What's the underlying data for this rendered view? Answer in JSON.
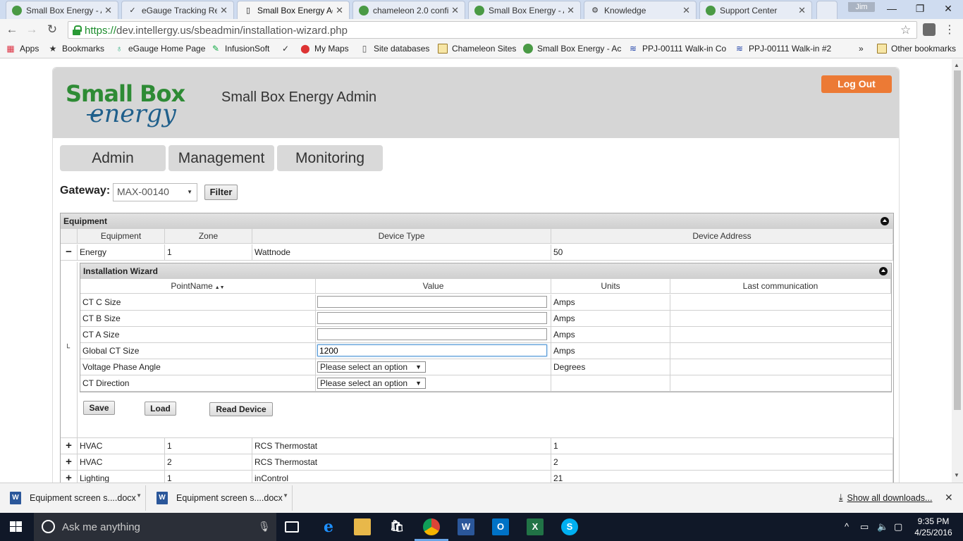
{
  "browser": {
    "tabs": [
      {
        "title": "Small Box Energy - A",
        "icon": "sbe-favicon"
      },
      {
        "title": "eGauge Tracking Re",
        "icon": "check-favicon"
      },
      {
        "title": "Small Box Energy Ad",
        "icon": "page-favicon",
        "active": true
      },
      {
        "title": "chameleon 2.0 confi",
        "icon": "sbe-favicon"
      },
      {
        "title": "Small Box Energy - A",
        "icon": "sbe-favicon"
      },
      {
        "title": "Knowledge",
        "icon": "gear-favicon"
      },
      {
        "title": "Support Center",
        "icon": "sbe-favicon"
      }
    ],
    "profile_name": "Jim",
    "url_scheme": "https://",
    "url_rest": "dev.intellergy.us/sbeadmin/installation-wizard.php",
    "bookmarks": [
      {
        "label": "Apps",
        "icon": "apps-grid-icon"
      },
      {
        "label": "Bookmarks",
        "icon": "star-icon"
      },
      {
        "label": "eGauge Home Page",
        "icon": "egauge-icon"
      },
      {
        "label": "InfusionSoft",
        "icon": "infusionsoft-icon"
      },
      {
        "label": "",
        "icon": "check-icon"
      },
      {
        "label": "My Maps",
        "icon": "map-pin-icon"
      },
      {
        "label": "Site databases",
        "icon": "page-icon"
      },
      {
        "label": "Chameleon Sites",
        "icon": "folder-icon"
      },
      {
        "label": "Small Box Energy - Ac",
        "icon": "sbe-favicon"
      },
      {
        "label": "PPJ-00111 Walk-in Co",
        "icon": "kcp-icon"
      },
      {
        "label": "PPJ-00111 Walk-in #2",
        "icon": "kcp-icon"
      }
    ],
    "more_bookmarks": "»",
    "other_bookmarks": "Other bookmarks"
  },
  "site": {
    "logo_top": "Small Box",
    "logo_bottom": "energy",
    "title": "Small Box Energy Admin",
    "logout_label": "Log Out",
    "nav": [
      "Admin",
      "Management",
      "Monitoring"
    ],
    "gateway_label": "Gateway:",
    "gateway_value": "MAX-00140",
    "filter_label": "Filter"
  },
  "equipment_grid": {
    "caption": "Equipment",
    "columns": [
      "Equipment",
      "Zone",
      "Device Type",
      "Device Address"
    ],
    "expanded_row": {
      "toggle": "−",
      "cells": [
        "Energy",
        "1",
        "Wattnode",
        "50"
      ]
    },
    "rows": [
      {
        "toggle": "+",
        "cells": [
          "HVAC",
          "1",
          "RCS Thermostat",
          "1"
        ]
      },
      {
        "toggle": "+",
        "cells": [
          "HVAC",
          "2",
          "RCS Thermostat",
          "2"
        ]
      },
      {
        "toggle": "+",
        "cells": [
          "Lighting",
          "1",
          "inControl",
          "21"
        ]
      }
    ]
  },
  "wizard": {
    "caption": "Installation Wizard",
    "columns": [
      "PointName",
      "Value",
      "Units",
      "Last communication"
    ],
    "sort_indicator": "▲▼",
    "rows": [
      {
        "name": "CT C Size",
        "type": "input",
        "value": "",
        "units": "Amps",
        "last": ""
      },
      {
        "name": "CT B Size",
        "type": "input",
        "value": "",
        "units": "Amps",
        "last": ""
      },
      {
        "name": "CT A Size",
        "type": "input",
        "value": "",
        "units": "Amps",
        "last": ""
      },
      {
        "name": "Global CT Size",
        "type": "input",
        "value": "1200",
        "units": "Amps",
        "last": "",
        "focused": true
      },
      {
        "name": "Voltage Phase Angle",
        "type": "select",
        "value": "Please select an option",
        "units": "Degrees",
        "last": ""
      },
      {
        "name": "CT Direction",
        "type": "select",
        "value": "Please select an option",
        "units": "",
        "last": ""
      }
    ],
    "buttons": {
      "save": "Save",
      "load": "Load",
      "read": "Read Device"
    }
  },
  "downloads": {
    "items": [
      "Equipment screen s....docx",
      "Equipment screen s....docx"
    ],
    "show_all": "Show all downloads..."
  },
  "taskbar": {
    "search_placeholder": "Ask me anything",
    "time": "9:35 PM",
    "date": "4/25/2016"
  }
}
